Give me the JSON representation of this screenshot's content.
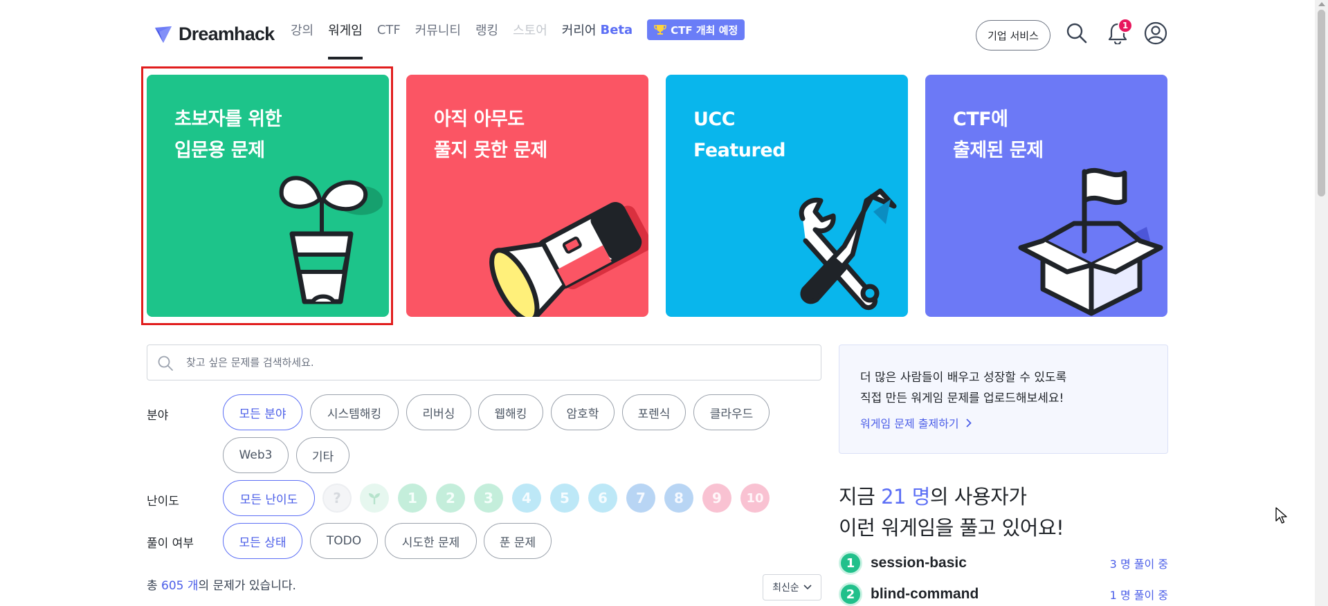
{
  "header": {
    "logo_text": "Dreamhack",
    "nav": [
      {
        "label": "강의"
      },
      {
        "label": "워게임"
      },
      {
        "label": "CTF"
      },
      {
        "label": "커뮤니티"
      },
      {
        "label": "랭킹"
      },
      {
        "label": "스토어"
      },
      {
        "label": "커리어"
      }
    ],
    "career_beta": "Beta",
    "ctf_badge": "CTF 개최 예정",
    "enterprise_button": "기업 서비스",
    "notification_count": "1"
  },
  "cards": [
    {
      "title": "초보자를 위한\n입문용 문제",
      "color": "#1dc48a"
    },
    {
      "title": "아직 아무도\n풀지 못한 문제",
      "color": "#fb5564"
    },
    {
      "title": "UCC\nFeatured",
      "color": "#09b6ec"
    },
    {
      "title": "CTF에\n출제된 문제",
      "color": "#6c79f6"
    }
  ],
  "search": {
    "placeholder": "찾고 싶은 문제를 검색하세요."
  },
  "filters": {
    "category": {
      "label": "분야",
      "options": [
        "모든 분야",
        "시스템해킹",
        "리버싱",
        "웹해킹",
        "암호학",
        "포렌식",
        "클라우드",
        "Web3",
        "기타"
      ]
    },
    "difficulty": {
      "label": "난이도",
      "all": "모든 난이도",
      "unknown": "?",
      "levels": [
        "1",
        "2",
        "3",
        "4",
        "5",
        "6",
        "7",
        "8",
        "9",
        "10"
      ]
    },
    "status": {
      "label": "풀이 여부",
      "options": [
        "모든 상태",
        "TODO",
        "시도한 문제",
        "푼 문제"
      ]
    }
  },
  "results": {
    "prefix": "총 ",
    "count": "605 개",
    "suffix": "의 문제가 있습니다.",
    "sort": "최신순"
  },
  "promo": {
    "text": "더 많은 사람들이 배우고 성장할 수 있도록\n직접 만든 워게임 문제를 업로드해보세요!",
    "link": "워게임 문제 출제하기"
  },
  "now_playing": {
    "title_prefix": "지금 ",
    "count": "21 명",
    "title_suffix": "의 사용자가",
    "title_line2": "이런 워게임을 풀고 있어요!",
    "items": [
      {
        "rank": "1",
        "name": "session-basic",
        "solving": "3 명 풀이 중"
      },
      {
        "rank": "2",
        "name": "blind-command",
        "solving": "1 명 풀이 중"
      }
    ]
  }
}
